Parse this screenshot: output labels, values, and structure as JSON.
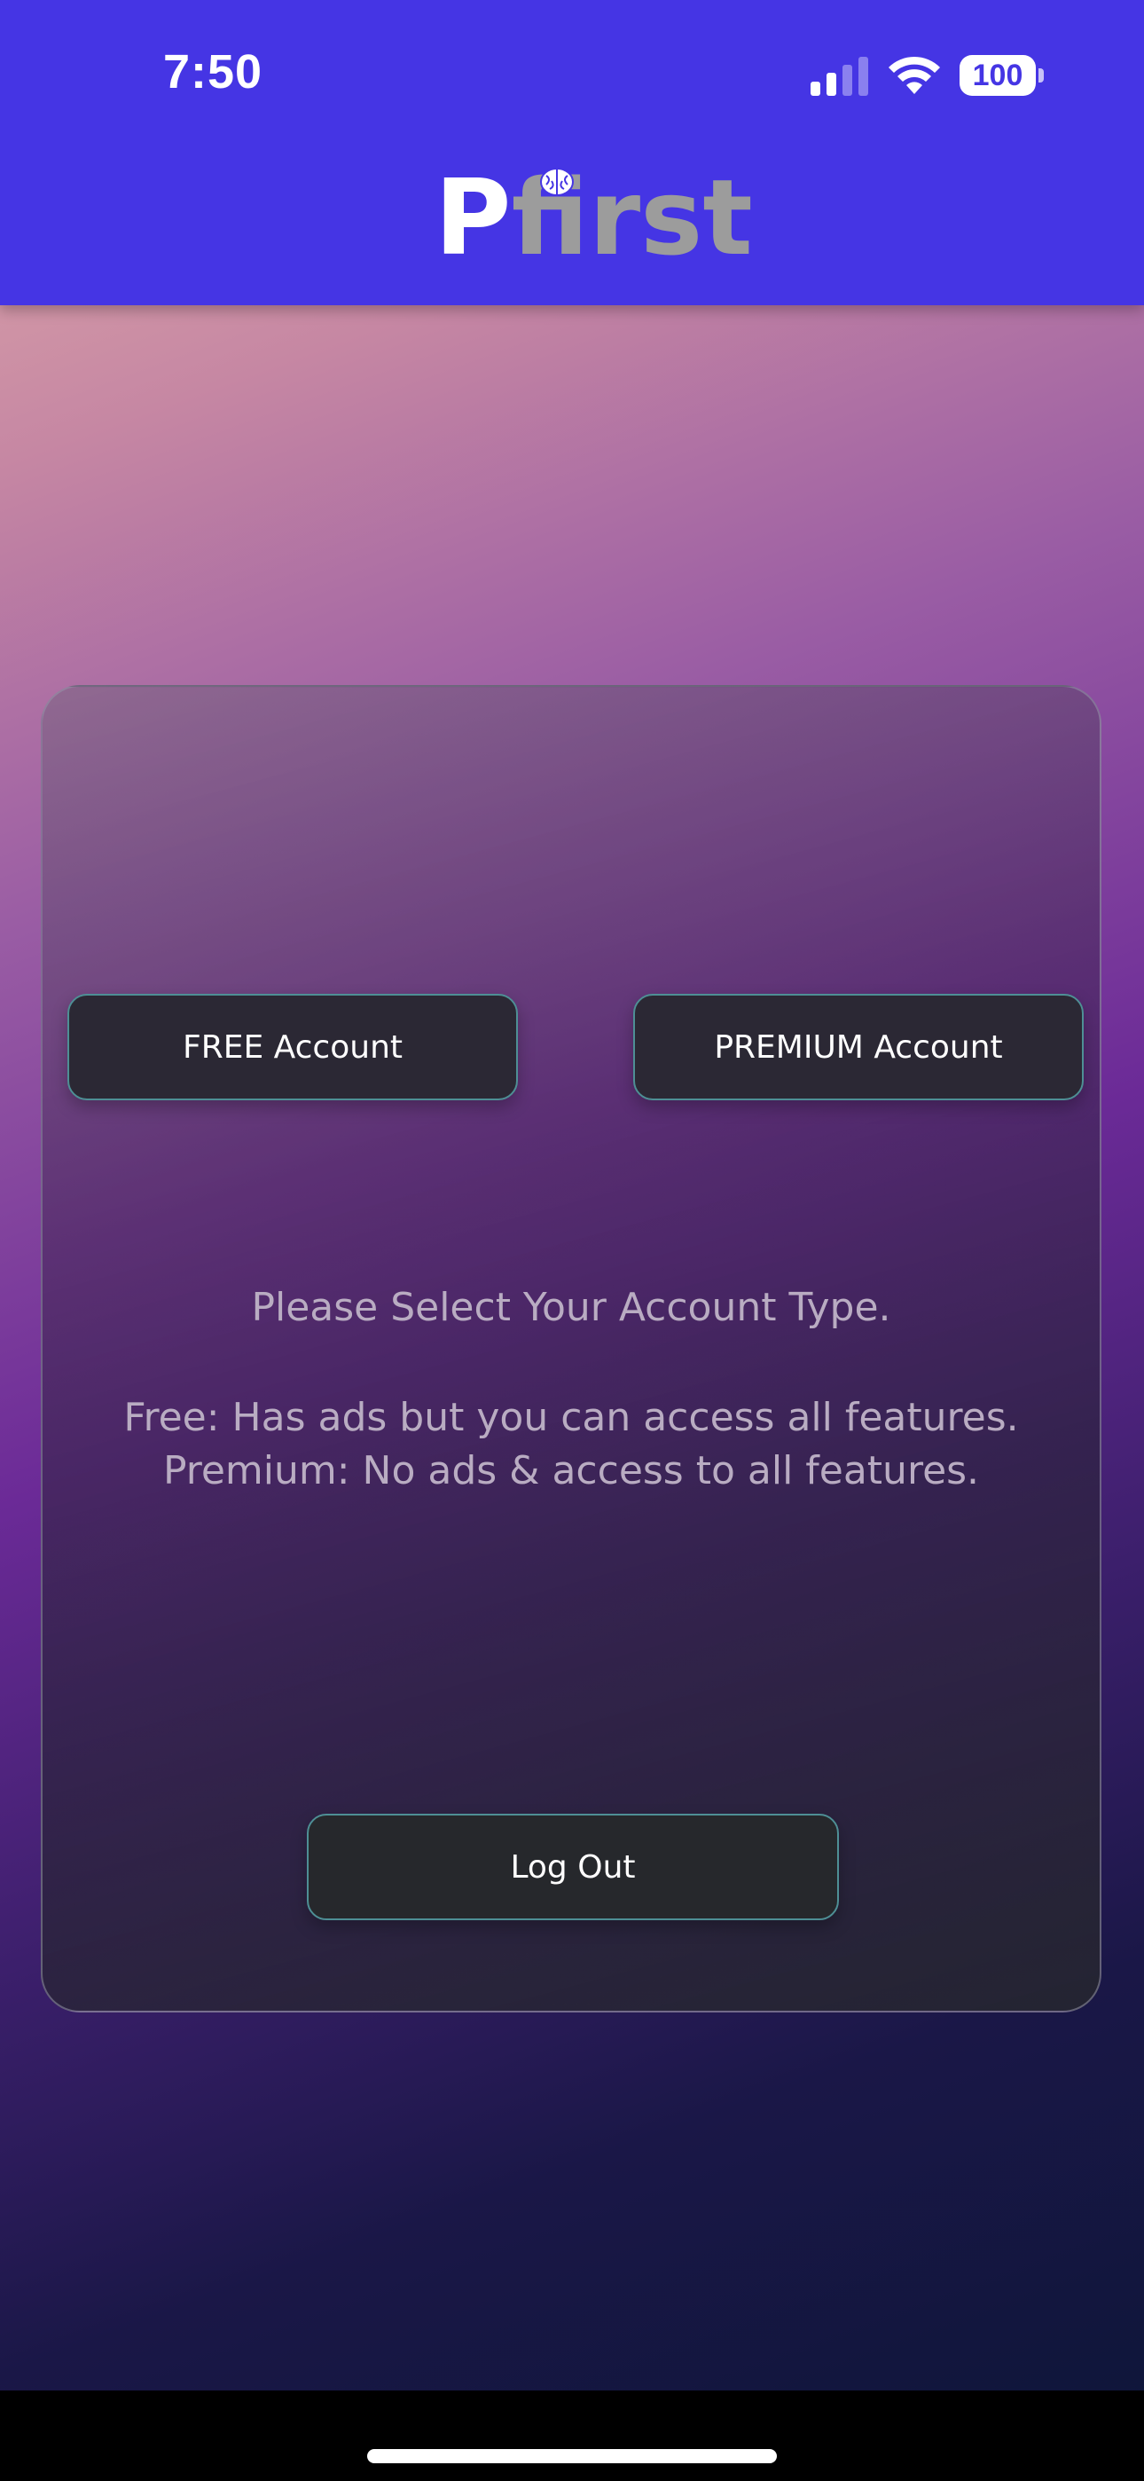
{
  "status_bar": {
    "time": "7:50",
    "battery": "100"
  },
  "app": {
    "logo_p": "P",
    "logo_rest": "first"
  },
  "card": {
    "free_button": "FREE Account",
    "premium_button": "PREMIUM Account",
    "prompt": "Please Select Your Account Type.",
    "free_desc": "Free: Has ads but you can access all features.",
    "premium_desc": "Premium: No ads & access to all features.",
    "logout_button": "Log Out"
  },
  "colors": {
    "header": "#4535e4",
    "button_border": "#4e8f95",
    "text_muted": "#b9acc2"
  }
}
